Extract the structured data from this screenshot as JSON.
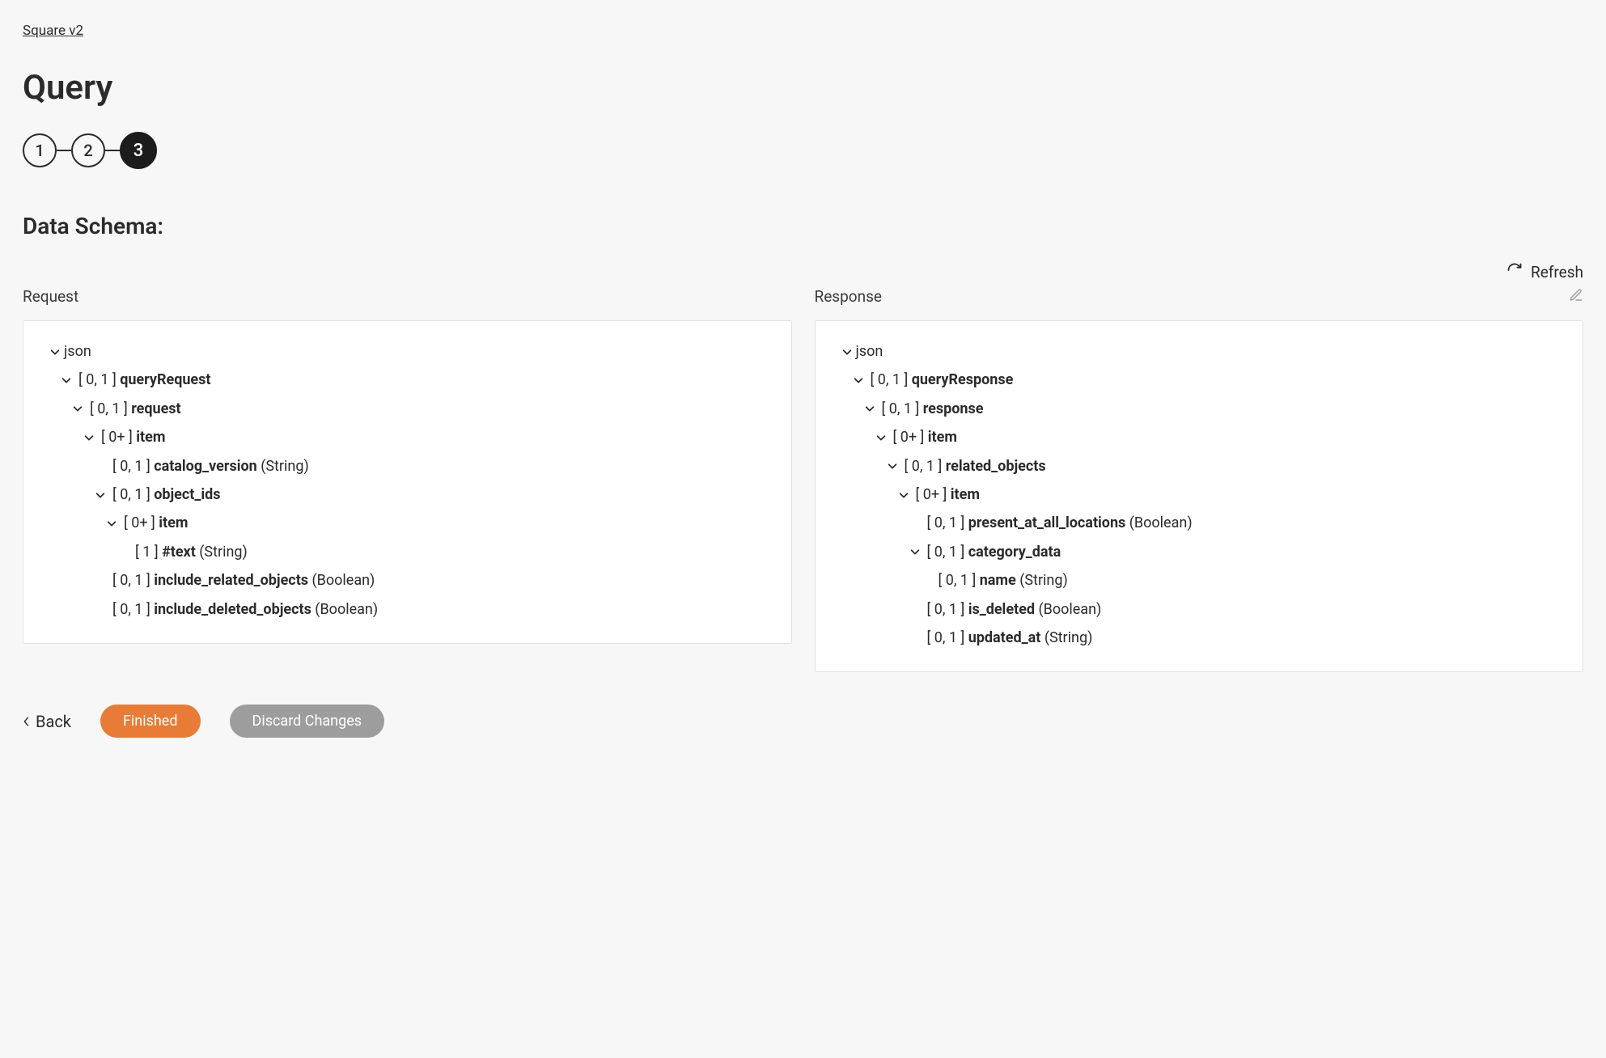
{
  "breadcrumb": "Square v2",
  "title": "Query",
  "steps": [
    "1",
    "2",
    "3"
  ],
  "activeStep": 2,
  "sectionTitle": "Data Schema:",
  "refreshLabel": "Refresh",
  "panes": {
    "request": {
      "label": "Request",
      "rows": [
        {
          "indent": 0,
          "chevron": true,
          "card": "",
          "name": "json",
          "bold": false,
          "type": ""
        },
        {
          "indent": 1,
          "chevron": true,
          "card": "[ 0, 1 ]",
          "name": "queryRequest",
          "bold": true,
          "type": ""
        },
        {
          "indent": 2,
          "chevron": true,
          "card": "[ 0, 1 ]",
          "name": "request",
          "bold": true,
          "type": ""
        },
        {
          "indent": 3,
          "chevron": true,
          "card": "[ 0+ ]",
          "name": "item",
          "bold": true,
          "type": ""
        },
        {
          "indent": 4,
          "chevron": false,
          "card": "[ 0, 1 ]",
          "name": "catalog_version",
          "bold": true,
          "type": "(String)"
        },
        {
          "indent": 4,
          "chevron": true,
          "card": "[ 0, 1 ]",
          "name": "object_ids",
          "bold": true,
          "type": ""
        },
        {
          "indent": 5,
          "chevron": true,
          "card": "[ 0+ ]",
          "name": "item",
          "bold": true,
          "type": ""
        },
        {
          "indent": 6,
          "chevron": false,
          "card": "[ 1 ]",
          "name": "#text",
          "bold": true,
          "type": "(String)"
        },
        {
          "indent": 4,
          "chevron": false,
          "card": "[ 0, 1 ]",
          "name": "include_related_objects",
          "bold": true,
          "type": "(Boolean)"
        },
        {
          "indent": 4,
          "chevron": false,
          "card": "[ 0, 1 ]",
          "name": "include_deleted_objects",
          "bold": true,
          "type": "(Boolean)"
        }
      ]
    },
    "response": {
      "label": "Response",
      "rows": [
        {
          "indent": 0,
          "chevron": true,
          "card": "",
          "name": "json",
          "bold": false,
          "type": ""
        },
        {
          "indent": 1,
          "chevron": true,
          "card": "[ 0, 1 ]",
          "name": "queryResponse",
          "bold": true,
          "type": ""
        },
        {
          "indent": 2,
          "chevron": true,
          "card": "[ 0, 1 ]",
          "name": "response",
          "bold": true,
          "type": ""
        },
        {
          "indent": 3,
          "chevron": true,
          "card": "[ 0+ ]",
          "name": "item",
          "bold": true,
          "type": ""
        },
        {
          "indent": 4,
          "chevron": true,
          "card": "[ 0, 1 ]",
          "name": "related_objects",
          "bold": true,
          "type": ""
        },
        {
          "indent": 5,
          "chevron": true,
          "card": "[ 0+ ]",
          "name": "item",
          "bold": true,
          "type": ""
        },
        {
          "indent": 6,
          "chevron": false,
          "card": "[ 0, 1 ]",
          "name": "present_at_all_locations",
          "bold": true,
          "type": "(Boolean)"
        },
        {
          "indent": 6,
          "chevron": true,
          "card": "[ 0, 1 ]",
          "name": "category_data",
          "bold": true,
          "type": ""
        },
        {
          "indent": 6,
          "chevron": false,
          "indentExtra": 1,
          "card": "[ 0, 1 ]",
          "name": "name",
          "bold": true,
          "type": "(String)"
        },
        {
          "indent": 6,
          "chevron": false,
          "card": "[ 0, 1 ]",
          "name": "is_deleted",
          "bold": true,
          "type": "(Boolean)"
        },
        {
          "indent": 6,
          "chevron": false,
          "card": "[ 0, 1 ]",
          "name": "updated_at",
          "bold": true,
          "type": "(String)"
        }
      ]
    }
  },
  "footer": {
    "back": "Back",
    "finished": "Finished",
    "discard": "Discard Changes"
  }
}
